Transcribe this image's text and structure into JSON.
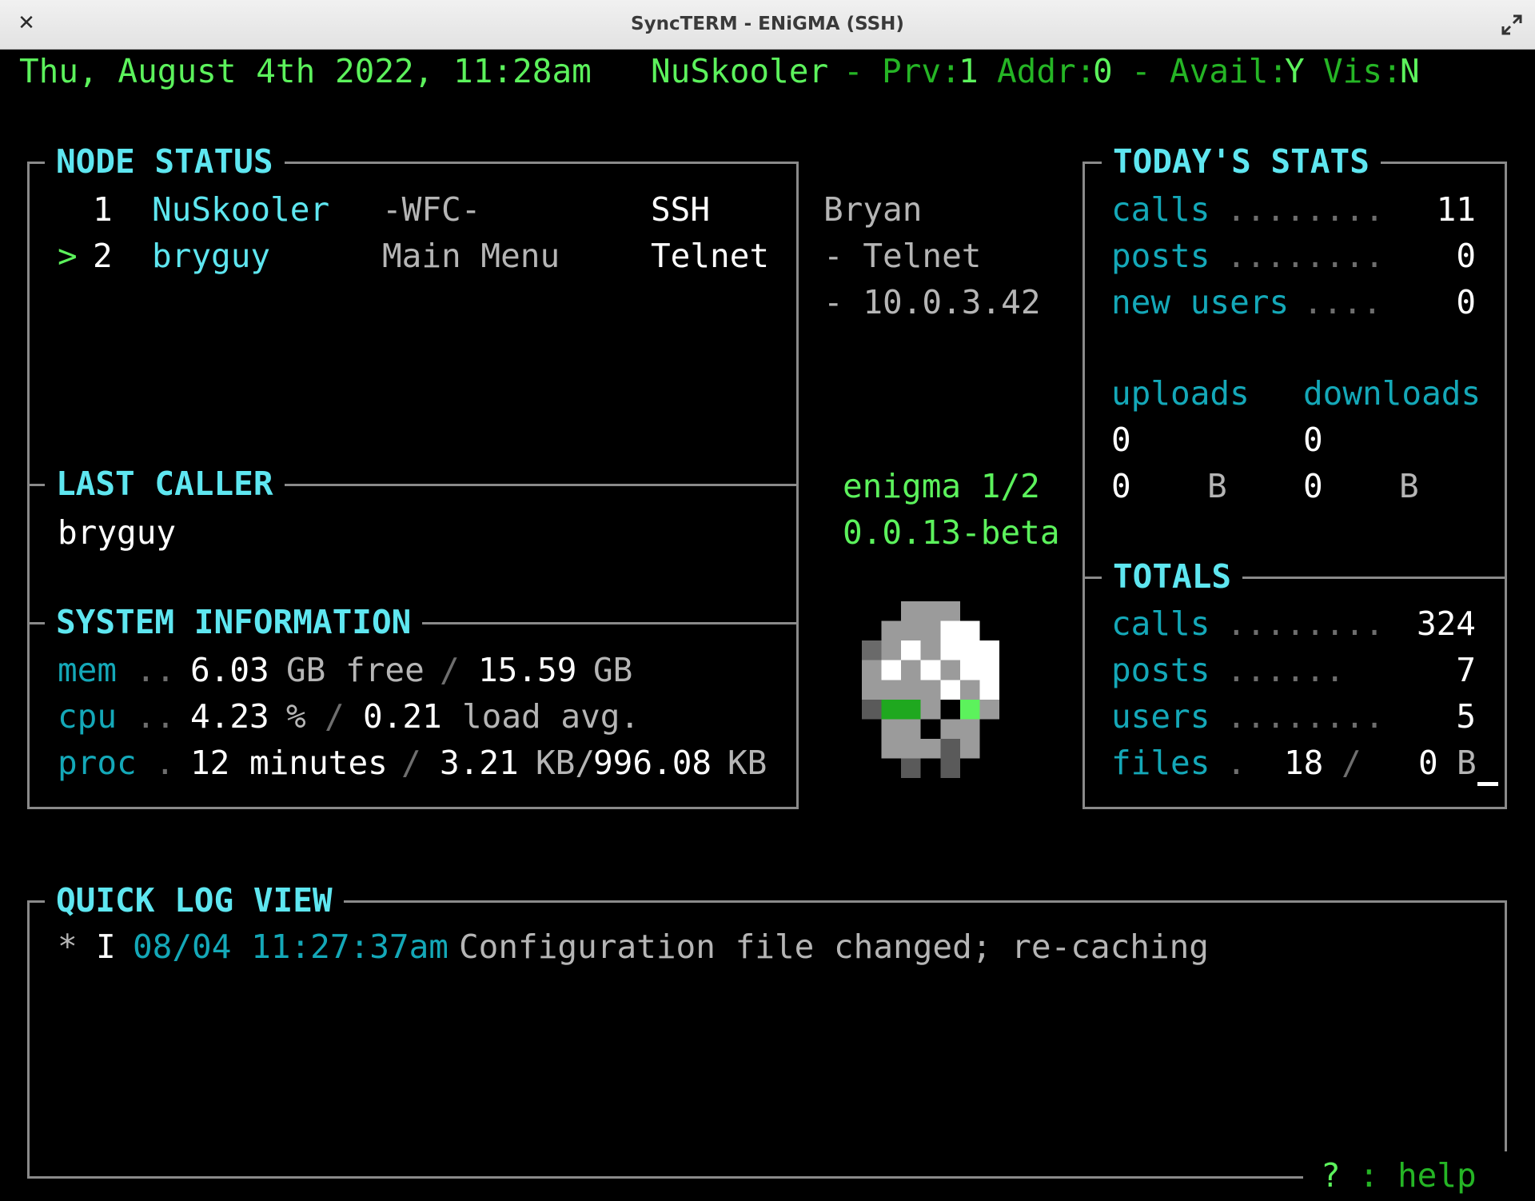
{
  "window": {
    "title": "SyncTERM - ENiGMA (SSH)",
    "close_glyph": "✕"
  },
  "status_line": {
    "date": "Thu, August 4th 2022, 11:28am",
    "user": "NuSkooler",
    "dash1": "-",
    "prv_label": "Prv:",
    "prv_value": "1",
    "addr_label": "Addr:",
    "addr_value": "0",
    "dash2": "-",
    "avail_label": "Avail:",
    "avail_value": "Y",
    "vis_label": "Vis:",
    "vis_value": "N"
  },
  "node_status": {
    "label": "NODE STATUS",
    "rows": [
      {
        "marker": "",
        "node": "1",
        "user": "NuSkooler",
        "action": "-WFC-",
        "proto": "SSH"
      },
      {
        "marker": ">",
        "node": "2",
        "user": "bryguy",
        "action": "Main Menu",
        "proto": "Telnet"
      }
    ]
  },
  "node_detail": {
    "name": "Bryan",
    "line2": "- Telnet",
    "line3": "- 10.0.3.42"
  },
  "last_caller": {
    "label": "LAST CALLER",
    "name": "bryguy"
  },
  "system_info": {
    "label": "SYSTEM INFORMATION",
    "mem": {
      "key": "mem",
      "dots": "..",
      "free": "6.03",
      "free_unit": "GB free",
      "sep": "/",
      "total": "15.59",
      "total_unit": "GB"
    },
    "cpu": {
      "key": "cpu",
      "dots": "..",
      "pct": "4.23",
      "pct_unit": "%",
      "sep": "/",
      "load": "0.21",
      "load_unit": "load avg."
    },
    "proc": {
      "key": "proc",
      "dots": ".",
      "uptime": "12 minutes",
      "sep": "/",
      "used": "3.21",
      "used_unit": "KB/",
      "total": "996.08",
      "total_unit": "KB"
    }
  },
  "version": {
    "name": "enigma 1/2",
    "number": "0.0.13-beta"
  },
  "todays_stats": {
    "label": "TODAY'S STATS",
    "calls": {
      "key": "calls",
      "dots": "........",
      "value": "11"
    },
    "posts": {
      "key": "posts",
      "dots": "........",
      "value": "0"
    },
    "new_users": {
      "key": "new users",
      "dots": "....",
      "value": "0"
    },
    "uploads_label": "uploads",
    "downloads_label": "downloads",
    "uploads_count": "0",
    "downloads_count": "0",
    "uploads_bytes": "0",
    "uploads_unit": "B",
    "downloads_bytes": "0",
    "downloads_unit": "B"
  },
  "totals": {
    "label": "TOTALS",
    "calls": {
      "key": "calls",
      "dots": "........",
      "value": "324"
    },
    "posts": {
      "key": "posts",
      "dots": "......",
      "value": "7"
    },
    "users": {
      "key": "users",
      "dots": "........",
      "value": "5"
    },
    "files": {
      "key": "files",
      "dots": ".",
      "count": "18",
      "sep": "/",
      "bytes": "0",
      "unit": "B"
    }
  },
  "quick_log": {
    "label": "QUICK LOG VIEW",
    "entries": [
      {
        "bullet": "*",
        "level": "I",
        "timestamp": "08/04 11:27:37am",
        "message": "Configuration file changed; re-caching"
      }
    ]
  },
  "help": {
    "key": "?",
    "sep": ":",
    "label": "help"
  },
  "colors": {
    "bright_green": "#5cf25c",
    "dark_green": "#25b525",
    "bright_cyan": "#5ee6f0",
    "dark_cyan": "#14a8b8",
    "box_line": "#8a8a8a"
  }
}
